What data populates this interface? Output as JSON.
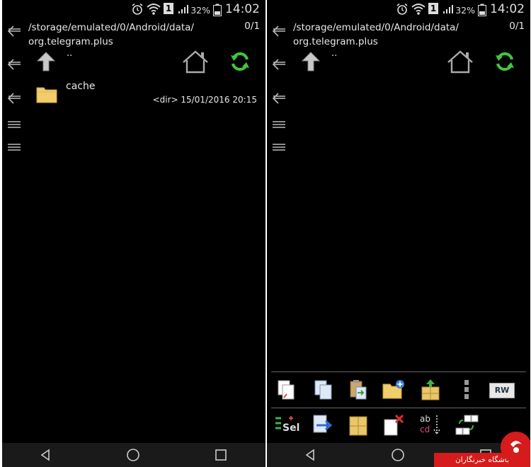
{
  "status": {
    "time": "14:02",
    "battery": "32%",
    "sim": "1"
  },
  "path": {
    "line1": "/storage/emulated/0/Android/data/",
    "line2": "org.telegram.plus"
  },
  "selection_count": "0/1",
  "parent_label": "..",
  "left_panel": {
    "files": [
      {
        "name": "cache",
        "type": "<dir>",
        "date": "15/01/2016",
        "time": "20:15"
      }
    ]
  },
  "watermark": {
    "text": "باشگاه خبرنگاران"
  },
  "icons": {
    "back": "back-arrow-icon",
    "menu": "hamburger-icon",
    "up": "up-arrow-icon",
    "home": "home-icon",
    "refresh": "refresh-icon",
    "folder": "folder-icon"
  },
  "toolbar": {
    "row1": [
      "copy-icon",
      "duplicate-icon",
      "paste-icon",
      "new-folder-icon",
      "pack-icon",
      "more-icon",
      "rw-icon"
    ],
    "row2": [
      "select-icon",
      "move-icon",
      "box-icon",
      "delete-icon",
      "rename-icon",
      "sort-icon"
    ],
    "rw_label": "RW",
    "sel_label": "Sel",
    "rename_label_top": "ab",
    "rename_label_bottom": "cd"
  },
  "colors": {
    "accent_green": "#43c43e",
    "folder": "#f2cd6b",
    "badge": "#d51b1b"
  }
}
